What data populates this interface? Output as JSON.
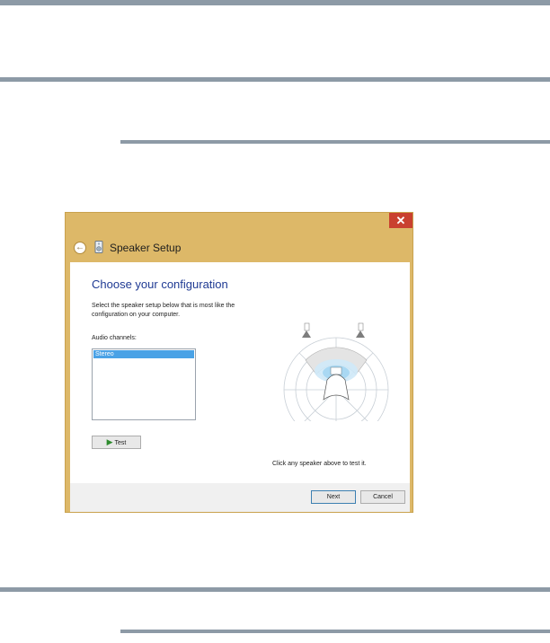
{
  "window": {
    "title": "Speaker Setup",
    "close_glyph": "✕",
    "back_glyph": "←"
  },
  "content": {
    "heading": "Choose your configuration",
    "description": "Select the speaker setup below that is most like the configuration on your computer.",
    "channels_label": "Audio channels:",
    "channels_options": [
      "Stereo"
    ],
    "selected_channel": "Stereo",
    "test_label": "Test",
    "hint": "Click any speaker above to test it.",
    "speakers": [
      "L",
      "R"
    ]
  },
  "footer": {
    "next_label": "Next",
    "cancel_label": "Cancel"
  },
  "colors": {
    "titlebar": "#ddb868",
    "close": "#c9402f",
    "heading": "#1f3a93",
    "selection": "#4aa2e6"
  }
}
